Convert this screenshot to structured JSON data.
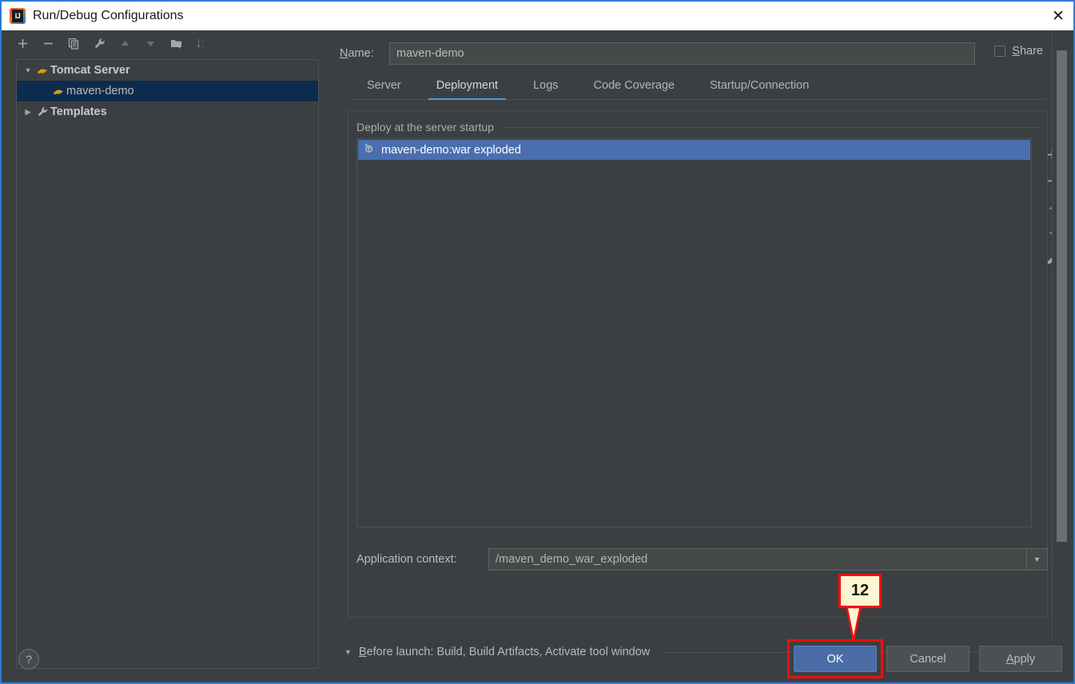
{
  "window": {
    "title": "Run/Debug Configurations",
    "app_icon": "intellij-idea-icon",
    "icon_text": "IJ",
    "close_icon": "✕",
    "accent_border": "#2d7cd6"
  },
  "tree_toolbar": {
    "buttons": [
      {
        "name": "add-configuration-button",
        "icon": "plus-icon",
        "enabled": true
      },
      {
        "name": "remove-configuration-button",
        "icon": "minus-icon",
        "enabled": true
      },
      {
        "name": "copy-configuration-button",
        "icon": "copy-icon",
        "enabled": true
      },
      {
        "name": "edit-templates-button",
        "icon": "wrench-icon",
        "enabled": true
      },
      {
        "name": "move-up-button",
        "icon": "arrow-up-icon",
        "enabled": false
      },
      {
        "name": "move-down-button",
        "icon": "arrow-down-icon",
        "enabled": false
      },
      {
        "name": "new-folder-button",
        "icon": "folder-add-icon",
        "enabled": true
      },
      {
        "name": "sort-configurations-button",
        "icon": "sort-az-icon",
        "enabled": false
      }
    ]
  },
  "tree": {
    "items": [
      {
        "label": "Tomcat Server",
        "icon": "tomcat-icon",
        "expanded": true,
        "level": 0,
        "selected": false,
        "bold": true
      },
      {
        "label": "maven-demo",
        "icon": "tomcat-icon",
        "expanded": null,
        "level": 1,
        "selected": true,
        "bold": false
      },
      {
        "label": "Templates",
        "icon": "wrench-icon",
        "expanded": false,
        "level": 0,
        "selected": false,
        "bold": true
      }
    ],
    "selection_color": "#0d2c4d"
  },
  "name_field": {
    "label": "Name:",
    "mnemonic": "N",
    "value": "maven-demo",
    "placeholder": ""
  },
  "share": {
    "label": "Share",
    "mnemonic": "S",
    "checked": false
  },
  "tabs": {
    "items": [
      {
        "label": "Server",
        "active": false
      },
      {
        "label": "Deployment",
        "active": true
      },
      {
        "label": "Logs",
        "active": false
      },
      {
        "label": "Code Coverage",
        "active": false
      },
      {
        "label": "Startup/Connection",
        "active": false
      }
    ],
    "active_underline_color": "#4a9ae0"
  },
  "deployment": {
    "legend": "Deploy at the server startup",
    "list": [
      {
        "label": "maven-demo:war exploded",
        "icon": "artifact-icon",
        "selected": true
      }
    ],
    "selection_color": "#4b6eaf",
    "side_buttons": [
      {
        "name": "add-artifact-button",
        "icon": "plus-icon",
        "enabled": true
      },
      {
        "name": "remove-artifact-button",
        "icon": "minus-icon",
        "enabled": true
      },
      {
        "name": "move-artifact-up",
        "icon": "arrow-up-icon",
        "enabled": false
      },
      {
        "name": "move-artifact-down",
        "icon": "arrow-down-icon",
        "enabled": false
      },
      {
        "name": "edit-artifact-button",
        "icon": "pencil-icon",
        "enabled": true
      }
    ]
  },
  "application_context": {
    "label": "Application context:",
    "value": "/maven_demo_war_exploded",
    "dropdown_icon": "chevron-down-icon"
  },
  "before_launch": {
    "toggle_icon": "triangle-down-icon",
    "mnemonic": "B",
    "label_rest": "efore launch: Build, Build Artifacts, Activate tool window"
  },
  "bottom": {
    "help_label": "?",
    "ok_label": "OK",
    "cancel_label": "Cancel",
    "apply_label": "Apply",
    "apply_mnemonic": "A"
  },
  "annotation": {
    "step_number": "12",
    "highlight_color": "#f50d0d",
    "badge_background": "#fdf6d2",
    "target": "ok-button"
  }
}
